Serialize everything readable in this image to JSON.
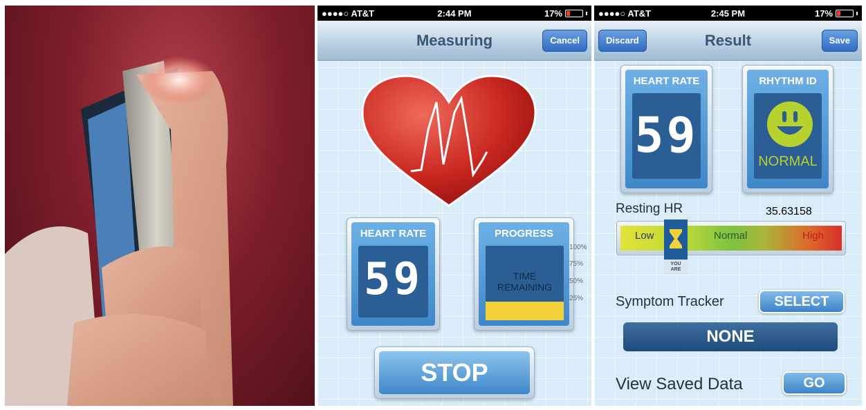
{
  "measure": {
    "status": {
      "carrier": "●●●●○ AT&T",
      "time": "2:44 PM",
      "battery": "17%"
    },
    "nav": {
      "title": "Measuring",
      "cancel_label": "Cancel"
    },
    "heart_rate": {
      "label": "HEART RATE",
      "value": "59"
    },
    "progress": {
      "label": "PROGRESS",
      "text_line1": "TIME",
      "text_line2": "REMAINING",
      "level": 0.25,
      "ticks": [
        "100%",
        "75%",
        "50%",
        "25%"
      ]
    },
    "stop_label": "STOP"
  },
  "result": {
    "status": {
      "carrier": "●●●●○ AT&T",
      "time": "2:45 PM",
      "battery": "17%"
    },
    "nav": {
      "title": "Result",
      "discard_label": "Discard",
      "save_label": "Save"
    },
    "heart_rate": {
      "label": "HEART RATE",
      "value": "59"
    },
    "rhythm": {
      "label": "RHYTHM ID",
      "status": "NORMAL"
    },
    "resting": {
      "label": "Resting HR",
      "value": "35.63158",
      "low": "Low",
      "normal": "Normal",
      "high": "High",
      "marker_line1": "YOU",
      "marker_line2": "ARE"
    },
    "symptom": {
      "label": "Symptom Tracker",
      "button": "SELECT",
      "value": "NONE"
    },
    "saved": {
      "label": "View Saved Data",
      "button": "GO"
    }
  },
  "colors": {
    "accent": "#3f87c9",
    "heart": "#c62828",
    "progress_fill": "#f2d23b",
    "smile": "#b7d22f"
  }
}
